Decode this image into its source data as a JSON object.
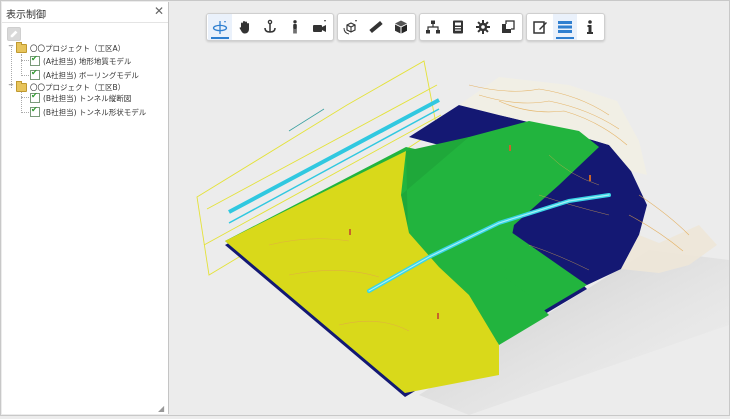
{
  "panel": {
    "title": "表示制御",
    "close_icon": "close-icon",
    "tool_icon": "edit-icon"
  },
  "tree": [
    {
      "label": "〇〇プロジェクト（工区A）",
      "expanded": true,
      "children": [
        {
          "label": "(A社担当) 地形地質モデル",
          "checked": true
        },
        {
          "label": "(A社担当) ボーリングモデル",
          "checked": true
        }
      ]
    },
    {
      "label": "〇〇プロジェクト（工区B）",
      "expanded": true,
      "children": [
        {
          "label": "(B社担当) トンネル縦断図",
          "checked": true
        },
        {
          "label": "(B社担当) トンネル形状モデル",
          "checked": true
        }
      ]
    }
  ],
  "toolbar": {
    "groups": [
      [
        "rotate-icon",
        "pan-hand-icon",
        "anchor-icon",
        "walk-person-icon",
        "camera-icon"
      ],
      [
        "cube-rotate-icon",
        "ruler-icon",
        "cube-icon"
      ],
      [
        "hierarchy-icon",
        "properties-icon",
        "gear-icon",
        "section-icon"
      ],
      [
        "edit-note-icon",
        "layers-icon",
        "info-icon"
      ]
    ],
    "active": [
      "rotate-icon",
      "layers-icon"
    ]
  },
  "colors": {
    "layer_yellow": "#d9d91a",
    "layer_green": "#22b43e",
    "layer_navy": "#141873",
    "tunnel": "#39d5e6",
    "contour": "#e2a64a",
    "accent": "#2f7fd0"
  }
}
